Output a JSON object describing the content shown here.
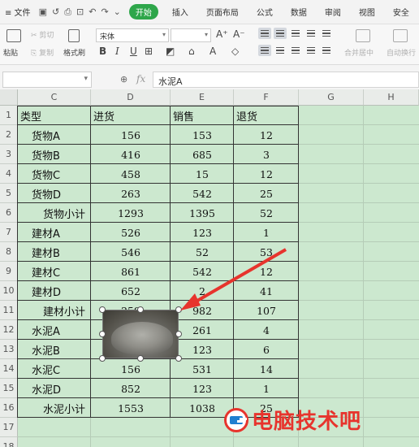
{
  "menubar": {
    "menu_label": "≡ 文件",
    "start_label": "开始",
    "tabs": [
      "插入",
      "页面布局",
      "公式",
      "数据",
      "审阅",
      "视图",
      "安全"
    ]
  },
  "ribbon": {
    "paste": "粘贴",
    "cut": "剪切",
    "copy": "复制",
    "format_painter": "格式刷",
    "font_name": "宋体",
    "merge": "合并居中",
    "wrap": "自动换行"
  },
  "formula_bar": {
    "fx": "fx",
    "content": "水泥A"
  },
  "columns": [
    "C",
    "D",
    "E",
    "F",
    "G",
    "H"
  ],
  "rows": [
    "1",
    "2",
    "3",
    "4",
    "5",
    "6",
    "7",
    "8",
    "9",
    "10",
    "11",
    "12",
    "13",
    "14",
    "15",
    "16",
    "17",
    "18"
  ],
  "table": {
    "header": [
      "类型",
      "进货",
      "销售",
      "退货"
    ],
    "data": [
      [
        "货物A",
        "156",
        "153",
        "12"
      ],
      [
        "货物B",
        "416",
        "685",
        "3"
      ],
      [
        "货物C",
        "458",
        "15",
        "12"
      ],
      [
        "货物D",
        "263",
        "542",
        "25"
      ],
      [
        "货物小计",
        "1293",
        "1395",
        "52"
      ],
      [
        "建材A",
        "526",
        "123",
        "1"
      ],
      [
        "建材B",
        "546",
        "52",
        "53"
      ],
      [
        "建材C",
        "861",
        "542",
        "12"
      ],
      [
        "建材D",
        "652",
        "2",
        "41"
      ],
      [
        "建材小计",
        "259",
        "982",
        "107"
      ],
      [
        "水泥A",
        "",
        "261",
        "4"
      ],
      [
        "水泥B",
        "",
        "123",
        "6"
      ],
      [
        "水泥C",
        "156",
        "531",
        "14"
      ],
      [
        "水泥D",
        "852",
        "123",
        "1"
      ],
      [
        "水泥小计",
        "1553",
        "1038",
        "25"
      ]
    ]
  },
  "watermark": "电脑技术吧",
  "colors": {
    "grid_bg": "#cce8cf",
    "start_green": "#2ea64a",
    "arrow_red": "#e7342d"
  }
}
